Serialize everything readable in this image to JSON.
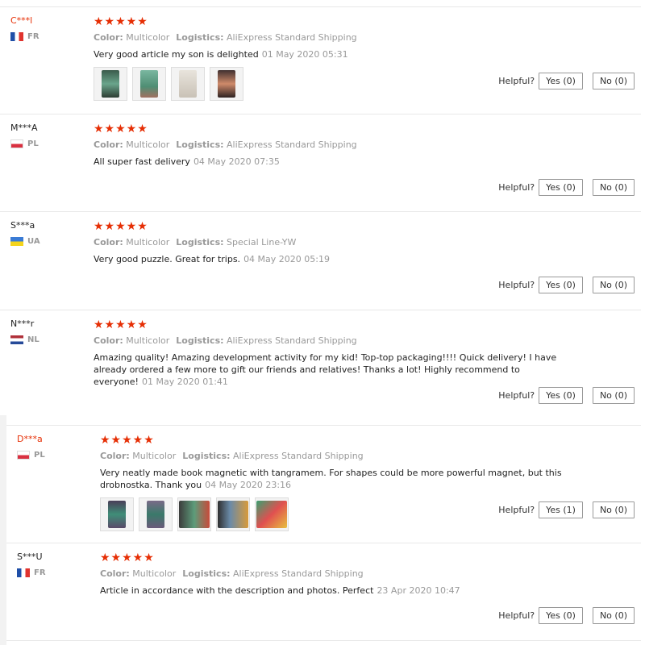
{
  "labels": {
    "color": "Color:",
    "logistics": "Logistics:",
    "helpful": "Helpful?"
  },
  "stars": "★★★★★",
  "reviews": [
    {
      "user": "C***l",
      "country": "FR",
      "color": "Multicolor",
      "logistics": "AliExpress Standard Shipping",
      "text": "Very good article my son is delighted",
      "date": "01 May 2020 05:31",
      "yes": "Yes (0)",
      "no": "No (0)"
    },
    {
      "user": "M***A",
      "country": "PL",
      "color": "Multicolor",
      "logistics": "AliExpress Standard Shipping",
      "text": "All super fast delivery",
      "date": "04 May 2020 07:35",
      "yes": "Yes (0)",
      "no": "No (0)"
    },
    {
      "user": "S***a",
      "country": "UA",
      "color": "Multicolor",
      "logistics": "Special Line-YW",
      "text": "Very good puzzle. Great for trips.",
      "date": "04 May 2020 05:19",
      "yes": "Yes (0)",
      "no": "No (0)"
    },
    {
      "user": "N***r",
      "country": "NL",
      "color": "Multicolor",
      "logistics": "AliExpress Standard Shipping",
      "text": "Amazing quality! Amazing development activity for my kid! Top-top packaging!!!! Quick delivery! I have already ordered a few more to gift our friends and relatives! Thanks a lot! Highly recommend to everyone!",
      "date": "01 May 2020 01:41",
      "yes": "Yes (0)",
      "no": "No (0)"
    },
    {
      "user": "D***a",
      "country": "PL",
      "color": "Multicolor",
      "logistics": "AliExpress Standard Shipping",
      "text": "Very neatly made book magnetic with tangramem. For shapes could be more powerful magnet, but this drobnostka. Thank you",
      "date": "04 May 2020 23:16",
      "yes": "Yes (1)",
      "no": "No (0)"
    },
    {
      "user": "S***U",
      "country": "FR",
      "color": "Multicolor",
      "logistics": "AliExpress Standard Shipping",
      "text": "Article in accordance with the description and photos. Perfect",
      "date": "23 Apr 2020 10:47",
      "yes": "Yes (0)",
      "no": "No (0)"
    }
  ],
  "colors": {
    "accent": "#e62e04",
    "muted": "#999999"
  }
}
